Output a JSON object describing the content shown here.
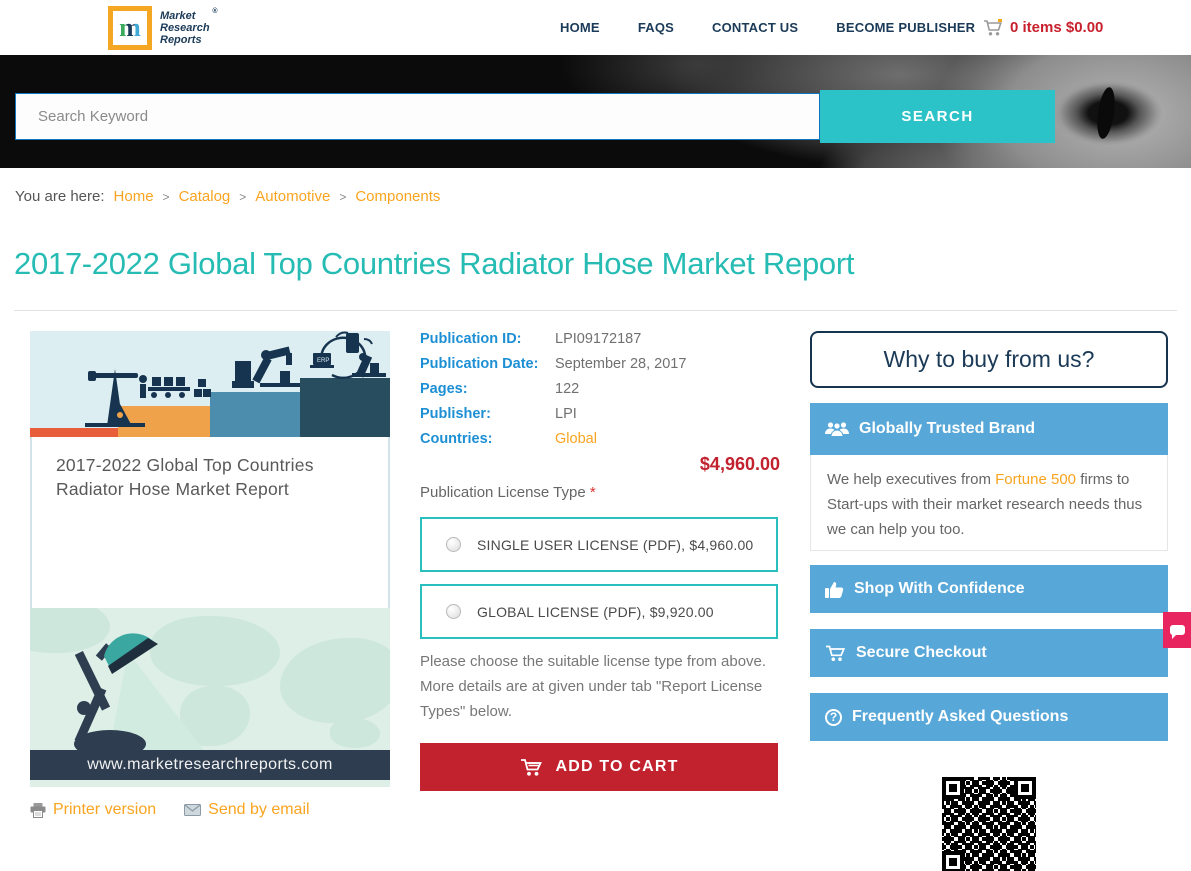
{
  "header": {
    "logo": {
      "m": "m",
      "line1": "Market",
      "line2": "Research",
      "line3": "Reports",
      "reg": "®"
    },
    "nav": [
      {
        "label": "HOME"
      },
      {
        "label": "FAQS"
      },
      {
        "label": "CONTACT US"
      },
      {
        "label": "BECOME PUBLISHER"
      }
    ],
    "cart": {
      "text": "0 items $0.00"
    }
  },
  "search": {
    "placeholder": "Search Keyword",
    "button_label": "SEARCH"
  },
  "breadcrumb": {
    "prefix": "You are here:",
    "separator": ">",
    "items": [
      {
        "label": "Home"
      },
      {
        "label": "Catalog"
      },
      {
        "label": "Automotive"
      },
      {
        "label": "Components"
      }
    ]
  },
  "page": {
    "title": "2017-2022 Global Top Countries Radiator Hose Market Report"
  },
  "product": {
    "cover": {
      "title": "2017-2022 Global Top Countries Radiator Hose Market Report",
      "url": "www.marketresearchreports.com"
    },
    "links": {
      "printer": "Printer version",
      "email": "Send by email"
    },
    "details": [
      {
        "label": "Publication ID:",
        "value": "LPI09172187"
      },
      {
        "label": "Publication Date:",
        "value": "September 28, 2017"
      },
      {
        "label": "Pages:",
        "value": "122"
      },
      {
        "label": "Publisher:",
        "value": "LPI"
      },
      {
        "label": "Countries:",
        "value": "Global"
      }
    ],
    "price": "$4,960.00",
    "license_section": {
      "label": "Publication License Type ",
      "required_mark": "*",
      "options": [
        {
          "label": "SINGLE USER LICENSE (PDF), $4,960.00"
        },
        {
          "label": "GLOBAL LICENSE (PDF), $9,920.00"
        }
      ],
      "note": "Please choose the suitable license type from above. More details are at given under tab \"Report License Types\" below."
    },
    "add_to_cart_label": "ADD TO CART"
  },
  "sidebar": {
    "heading": "Why to buy from us?",
    "sections": [
      {
        "title": "Globally Trusted Brand"
      },
      {
        "title": "Shop With Confidence"
      },
      {
        "title": "Secure Checkout"
      },
      {
        "title": "Frequently Asked Questions"
      }
    ],
    "trusted_body": {
      "before": "We help executives from ",
      "highlight": "Fortune 500",
      "after": " firms to Start-ups with their market research needs thus we can help you too."
    },
    "faq_glyph": "?"
  },
  "colors": {
    "accent_teal": "#2bc2c8",
    "title_teal": "#26bcb4",
    "brand_orange": "#f9a41f",
    "price_red": "#c2212e",
    "sidebar_blue": "#57a7d8",
    "navy": "#1b3a57",
    "label_blue": "#1d8fd4"
  }
}
